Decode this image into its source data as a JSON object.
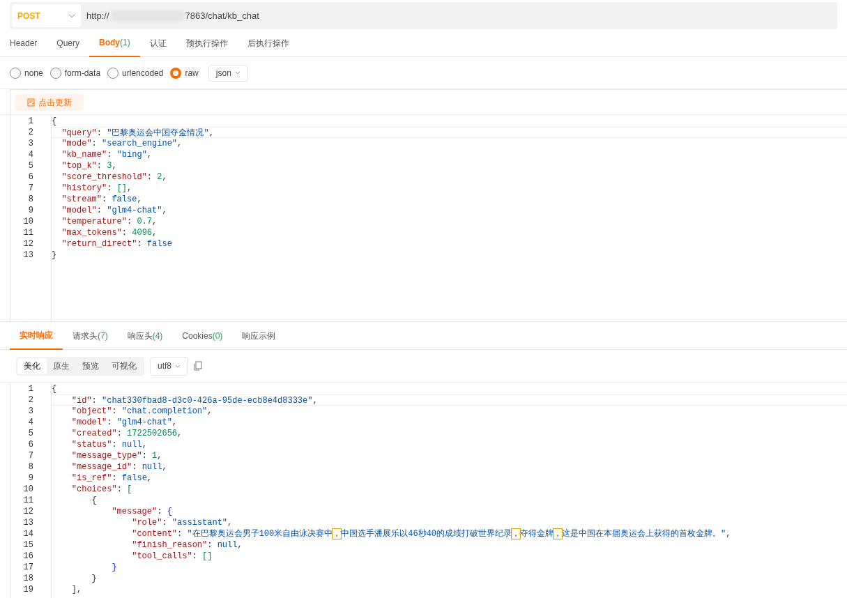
{
  "request": {
    "method": "POST",
    "url_prefix": "http://",
    "url_suffix": "7863/chat/kb_chat"
  },
  "request_tabs": [
    {
      "label": "Header",
      "selected": false
    },
    {
      "label": "Query",
      "selected": false
    },
    {
      "label": "Body",
      "count": "(1)",
      "selected": true
    },
    {
      "label": "认证",
      "selected": false
    },
    {
      "label": "预执行操作",
      "selected": false
    },
    {
      "label": "后执行操作",
      "selected": false
    }
  ],
  "body_types": [
    {
      "label": "none",
      "selected": false
    },
    {
      "label": "form-data",
      "selected": false
    },
    {
      "label": "urlencoded",
      "selected": false
    },
    {
      "label": "raw",
      "selected": true
    }
  ],
  "format": "json",
  "update_button": "点击更新",
  "request_code": [
    {
      "no": "1",
      "tokens": [
        {
          "kind": "p",
          "text": "{"
        }
      ]
    },
    {
      "no": "2",
      "tokens": [
        {
          "kind": "key",
          "text": "  \"query\""
        },
        {
          "kind": "p",
          "text": ": "
        },
        {
          "kind": "str",
          "text": "\"巴黎奥运会中国夺金情况\""
        },
        {
          "kind": "p",
          "text": ","
        }
      ]
    },
    {
      "no": "3",
      "tokens": [
        {
          "kind": "key",
          "text": "  \"mode\""
        },
        {
          "kind": "p",
          "text": ": "
        },
        {
          "kind": "str",
          "text": "\"search_engine\""
        },
        {
          "kind": "p",
          "text": ","
        }
      ]
    },
    {
      "no": "4",
      "tokens": [
        {
          "kind": "key",
          "text": "  \"kb_name\""
        },
        {
          "kind": "p",
          "text": ": "
        },
        {
          "kind": "str",
          "text": "\"bing\""
        },
        {
          "kind": "p",
          "text": ","
        }
      ]
    },
    {
      "no": "5",
      "tokens": [
        {
          "kind": "key",
          "text": "  \"top_k\""
        },
        {
          "kind": "p",
          "text": ": "
        },
        {
          "kind": "num",
          "text": "3"
        },
        {
          "kind": "p",
          "text": ","
        }
      ]
    },
    {
      "no": "6",
      "tokens": [
        {
          "kind": "key",
          "text": "  \"score_threshold\""
        },
        {
          "kind": "p",
          "text": ": "
        },
        {
          "kind": "num",
          "text": "2"
        },
        {
          "kind": "p",
          "text": ","
        }
      ]
    },
    {
      "no": "7",
      "tokens": [
        {
          "kind": "key",
          "text": "  \"history\""
        },
        {
          "kind": "p",
          "text": ": "
        },
        {
          "kind": "num",
          "text": "[]"
        },
        {
          "kind": "p",
          "text": ","
        }
      ]
    },
    {
      "no": "8",
      "tokens": [
        {
          "kind": "key",
          "text": "  \"stream\""
        },
        {
          "kind": "p",
          "text": ": "
        },
        {
          "kind": "kw",
          "text": "false"
        },
        {
          "kind": "p",
          "text": ","
        }
      ]
    },
    {
      "no": "9",
      "tokens": [
        {
          "kind": "key",
          "text": "  \"model\""
        },
        {
          "kind": "p",
          "text": ": "
        },
        {
          "kind": "str",
          "text": "\"glm4-chat\""
        },
        {
          "kind": "p",
          "text": ","
        }
      ]
    },
    {
      "no": "10",
      "tokens": [
        {
          "kind": "key",
          "text": "  \"temperature\""
        },
        {
          "kind": "p",
          "text": ": "
        },
        {
          "kind": "num",
          "text": "0.7"
        },
        {
          "kind": "p",
          "text": ","
        }
      ]
    },
    {
      "no": "11",
      "tokens": [
        {
          "kind": "key",
          "text": "  \"max_tokens\""
        },
        {
          "kind": "p",
          "text": ": "
        },
        {
          "kind": "num",
          "text": "4096"
        },
        {
          "kind": "p",
          "text": ","
        }
      ]
    },
    {
      "no": "12",
      "tokens": [
        {
          "kind": "key",
          "text": "  \"return_direct\""
        },
        {
          "kind": "p",
          "text": ": "
        },
        {
          "kind": "kw",
          "text": "false"
        }
      ]
    },
    {
      "no": "13",
      "tokens": [
        {
          "kind": "p",
          "text": "}"
        }
      ]
    }
  ],
  "response_tabs": [
    {
      "label": "实时响应",
      "selected": true
    },
    {
      "label": "请求头",
      "count": "(7)",
      "selected": false
    },
    {
      "label": "响应头",
      "count": "(4)",
      "selected": false
    },
    {
      "label": "Cookies",
      "count": "(0)",
      "selected": false
    },
    {
      "label": "响应示例",
      "selected": false
    }
  ],
  "view_modes": [
    {
      "label": "美化",
      "selected": true
    },
    {
      "label": "原生",
      "selected": false
    },
    {
      "label": "预览",
      "selected": false
    },
    {
      "label": "可视化",
      "selected": false
    }
  ],
  "encoding": "utf8",
  "response_code": [
    {
      "no": "1",
      "tokens": [
        {
          "kind": "p",
          "text": "{"
        }
      ]
    },
    {
      "no": "2",
      "tokens": [
        {
          "kind": "key",
          "text": "    \"id\""
        },
        {
          "kind": "p",
          "text": ": "
        },
        {
          "kind": "str",
          "text": "\"chat330fbad8-d3c0-426a-95de-ecb8e4d8333e\""
        },
        {
          "kind": "p",
          "text": ","
        }
      ]
    },
    {
      "no": "3",
      "tokens": [
        {
          "kind": "key",
          "text": "    \"object\""
        },
        {
          "kind": "p",
          "text": ": "
        },
        {
          "kind": "str",
          "text": "\"chat.completion\""
        },
        {
          "kind": "p",
          "text": ","
        }
      ]
    },
    {
      "no": "4",
      "tokens": [
        {
          "kind": "key",
          "text": "    \"model\""
        },
        {
          "kind": "p",
          "text": ": "
        },
        {
          "kind": "str",
          "text": "\"glm4-chat\""
        },
        {
          "kind": "p",
          "text": ","
        }
      ]
    },
    {
      "no": "5",
      "tokens": [
        {
          "kind": "key",
          "text": "    \"created\""
        },
        {
          "kind": "p",
          "text": ": "
        },
        {
          "kind": "num",
          "text": "1722502656"
        },
        {
          "kind": "p",
          "text": ","
        }
      ]
    },
    {
      "no": "6",
      "tokens": [
        {
          "kind": "key",
          "text": "    \"status\""
        },
        {
          "kind": "p",
          "text": ": "
        },
        {
          "kind": "kw",
          "text": "null"
        },
        {
          "kind": "p",
          "text": ","
        }
      ]
    },
    {
      "no": "7",
      "tokens": [
        {
          "kind": "key",
          "text": "    \"message_type\""
        },
        {
          "kind": "p",
          "text": ": "
        },
        {
          "kind": "num",
          "text": "1"
        },
        {
          "kind": "p",
          "text": ","
        }
      ]
    },
    {
      "no": "8",
      "tokens": [
        {
          "kind": "key",
          "text": "    \"message_id\""
        },
        {
          "kind": "p",
          "text": ": "
        },
        {
          "kind": "kw",
          "text": "null"
        },
        {
          "kind": "p",
          "text": ","
        }
      ]
    },
    {
      "no": "9",
      "tokens": [
        {
          "kind": "key",
          "text": "    \"is_ref\""
        },
        {
          "kind": "p",
          "text": ": "
        },
        {
          "kind": "kw",
          "text": "false"
        },
        {
          "kind": "p",
          "text": ","
        }
      ]
    },
    {
      "no": "10",
      "tokens": [
        {
          "kind": "key",
          "text": "    \"choices\""
        },
        {
          "kind": "p",
          "text": ": "
        },
        {
          "kind": "num",
          "text": "["
        }
      ]
    },
    {
      "no": "11",
      "tokens": [
        {
          "kind": "p",
          "text": "        {"
        }
      ]
    },
    {
      "no": "12",
      "tokens": [
        {
          "kind": "key",
          "text": "            \"message\""
        },
        {
          "kind": "p",
          "text": ": "
        },
        {
          "kind": "brace",
          "text": "{"
        }
      ]
    },
    {
      "no": "13",
      "tokens": [
        {
          "kind": "key",
          "text": "                \"role\""
        },
        {
          "kind": "p",
          "text": ": "
        },
        {
          "kind": "str",
          "text": "\"assistant\""
        },
        {
          "kind": "p",
          "text": ","
        }
      ]
    },
    {
      "no": "14",
      "tokens": [
        {
          "kind": "key",
          "text": "                \"content\""
        },
        {
          "kind": "p",
          "text": ": "
        },
        {
          "kind": "str",
          "text": "\"在巴黎奥运会男子100米自由泳决赛中"
        },
        {
          "kind": "hl",
          "text": "，"
        },
        {
          "kind": "str",
          "text": "中国选手潘展乐以46秒40的成绩打破世界纪录"
        },
        {
          "kind": "hl",
          "text": "，"
        },
        {
          "kind": "str",
          "text": "夺得金牌"
        },
        {
          "kind": "hl",
          "text": "，"
        },
        {
          "kind": "str",
          "text": "这是中国在本届奥运会上获得的首枚金牌。\""
        },
        {
          "kind": "p",
          "text": ","
        }
      ]
    },
    {
      "no": "15",
      "tokens": [
        {
          "kind": "key",
          "text": "                \"finish_reason\""
        },
        {
          "kind": "p",
          "text": ": "
        },
        {
          "kind": "kw",
          "text": "null"
        },
        {
          "kind": "p",
          "text": ","
        }
      ]
    },
    {
      "no": "16",
      "tokens": [
        {
          "kind": "key",
          "text": "                \"tool_calls\""
        },
        {
          "kind": "p",
          "text": ": "
        },
        {
          "kind": "num",
          "text": "[]"
        }
      ]
    },
    {
      "no": "17",
      "tokens": [
        {
          "kind": "brace",
          "text": "            }"
        }
      ]
    },
    {
      "no": "18",
      "tokens": [
        {
          "kind": "p",
          "text": "        }"
        }
      ]
    },
    {
      "no": "19",
      "tokens": [
        {
          "kind": "p",
          "text": "    ],"
        }
      ]
    }
  ]
}
